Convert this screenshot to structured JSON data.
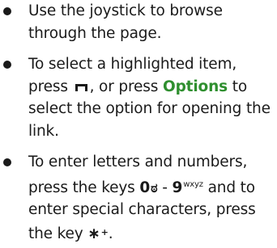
{
  "items": [
    {
      "text": "Use the joystick to browse through the page."
    },
    {
      "part1": "To select a highlighted item, press",
      "part2": ", or press",
      "softkey": "Options",
      "part3": "to select the option for opening the link."
    },
    {
      "part1": "To enter letters and numbers, press the keys",
      "key0": "0",
      "key0_glyph": "ಠ",
      "dash": "-",
      "key9": "9",
      "key9_sup": "wxyz",
      "part2": "and to enter special characters, press the key",
      "star": "∗",
      "star_sup": "+",
      "end": "."
    }
  ],
  "icons": {
    "select_key": "select-key-icon"
  },
  "colors": {
    "softkey": "#2f8f2f",
    "text": "#1a1a1a"
  }
}
